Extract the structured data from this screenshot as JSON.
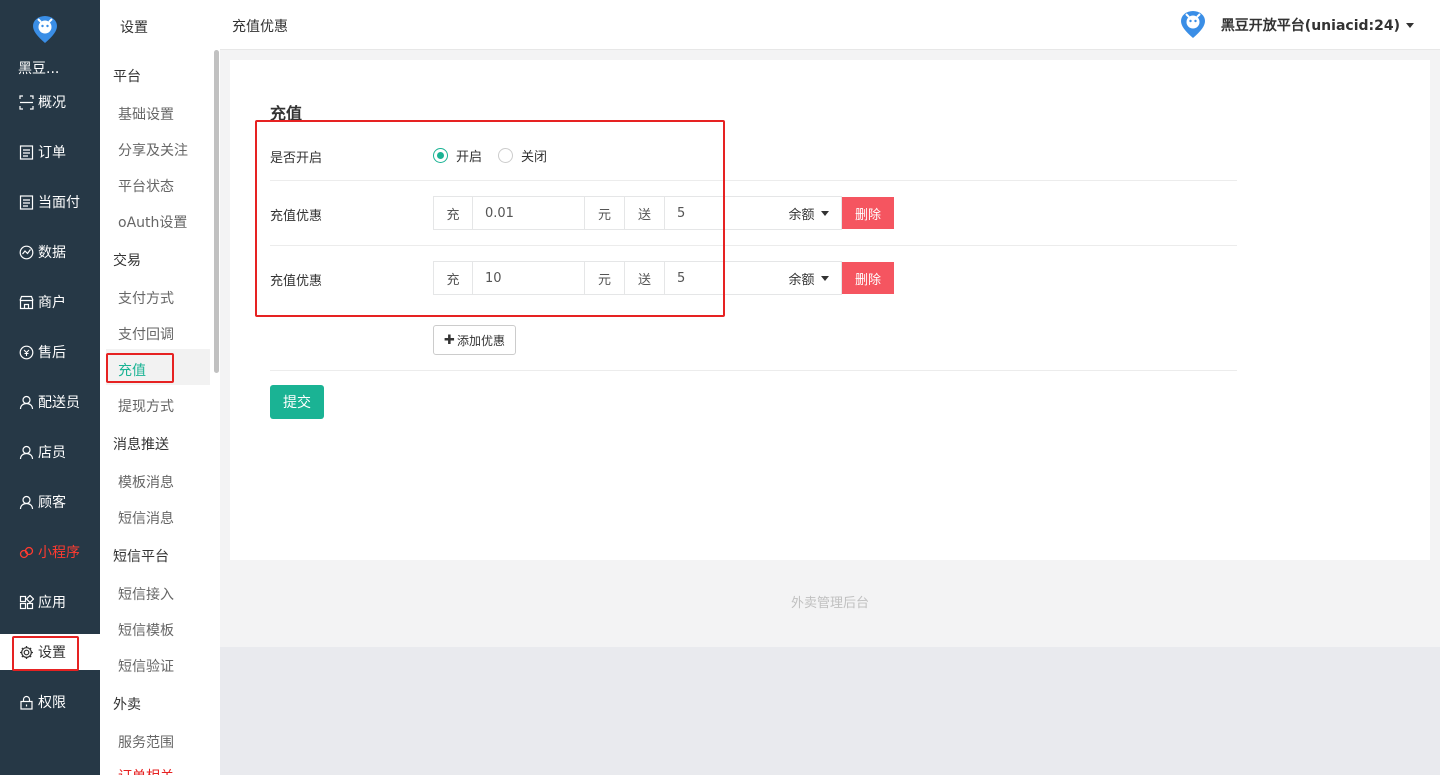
{
  "nav": {
    "brand": "黑豆...",
    "items": [
      {
        "label": "概况",
        "icon": "overview-icon"
      },
      {
        "label": "订单",
        "icon": "order-icon"
      },
      {
        "label": "当面付",
        "icon": "pay-icon"
      },
      {
        "label": "数据",
        "icon": "chart-icon"
      },
      {
        "label": "商户",
        "icon": "store-icon"
      },
      {
        "label": "售后",
        "icon": "aftersale-icon"
      },
      {
        "label": "配送员",
        "icon": "user-icon"
      },
      {
        "label": "店员",
        "icon": "user-icon"
      },
      {
        "label": "顾客",
        "icon": "user-icon"
      },
      {
        "label": "小程序",
        "icon": "miniapp-icon"
      },
      {
        "label": "应用",
        "icon": "apps-icon"
      },
      {
        "label": "设置",
        "icon": "gear-icon"
      },
      {
        "label": "权限",
        "icon": "lock-icon"
      }
    ]
  },
  "submenu": {
    "title": "设置",
    "groups": [
      {
        "head": "平台",
        "items": [
          "基础设置",
          "分享及关注",
          "平台状态",
          "oAuth设置"
        ]
      },
      {
        "head": "交易",
        "items": [
          "支付方式",
          "支付回调",
          "充值",
          "提现方式"
        ]
      },
      {
        "head": "消息推送",
        "items": [
          "模板消息",
          "短信消息"
        ]
      },
      {
        "head": "短信平台",
        "items": [
          "短信接入",
          "短信模板",
          "短信验证"
        ]
      },
      {
        "head": "外卖",
        "items": [
          "服务范围",
          "订单相关"
        ]
      }
    ]
  },
  "topbar": {
    "title": "充值优惠",
    "user": "黑豆开放平台(uniacid:24)"
  },
  "form": {
    "title": "充值",
    "enable_label": "是否开启",
    "radio_on": "开启",
    "radio_off": "关闭",
    "rows": [
      {
        "label": "充值优惠",
        "prefix": "充",
        "amount": "0.01",
        "unit": "元",
        "give": "送",
        "bonus": "5",
        "type": "余额",
        "delete": "删除"
      },
      {
        "label": "充值优惠",
        "prefix": "充",
        "amount": "10",
        "unit": "元",
        "give": "送",
        "bonus": "5",
        "type": "余额",
        "delete": "删除"
      }
    ],
    "add_label": "添加优惠",
    "submit_label": "提交"
  },
  "footer": "外卖管理后台",
  "colors": {
    "accent": "#1ab394",
    "danger": "#f55560",
    "nav_bg": "#263846",
    "highlight": "#e62222"
  }
}
